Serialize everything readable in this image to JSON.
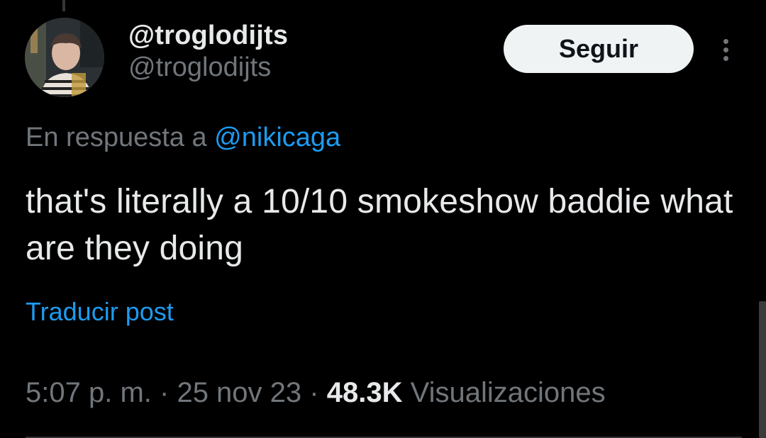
{
  "author": {
    "display_name": "@troglodijts",
    "handle": "@troglodijts",
    "avatar": "profile-photo"
  },
  "follow_button": {
    "label": "Seguir"
  },
  "more_menu": {
    "icon": "more-vertical-icon"
  },
  "reply_context": {
    "prefix": "En respuesta a ",
    "mention": "@nikicaga"
  },
  "tweet": {
    "text": "that's literally a 10/10 smokeshow baddie what are they doing"
  },
  "translate_link": "Traducir post",
  "meta": {
    "time": "5:07 p. m.",
    "separator": "·",
    "date": "25 nov 23",
    "views_count": "48.3K",
    "views_label": "Visualizaciones"
  },
  "colors": {
    "background": "#000000",
    "text_primary": "#e7e9ea",
    "text_secondary": "#71767b",
    "link": "#1d9bf0",
    "follow_bg": "#eff3f4"
  }
}
